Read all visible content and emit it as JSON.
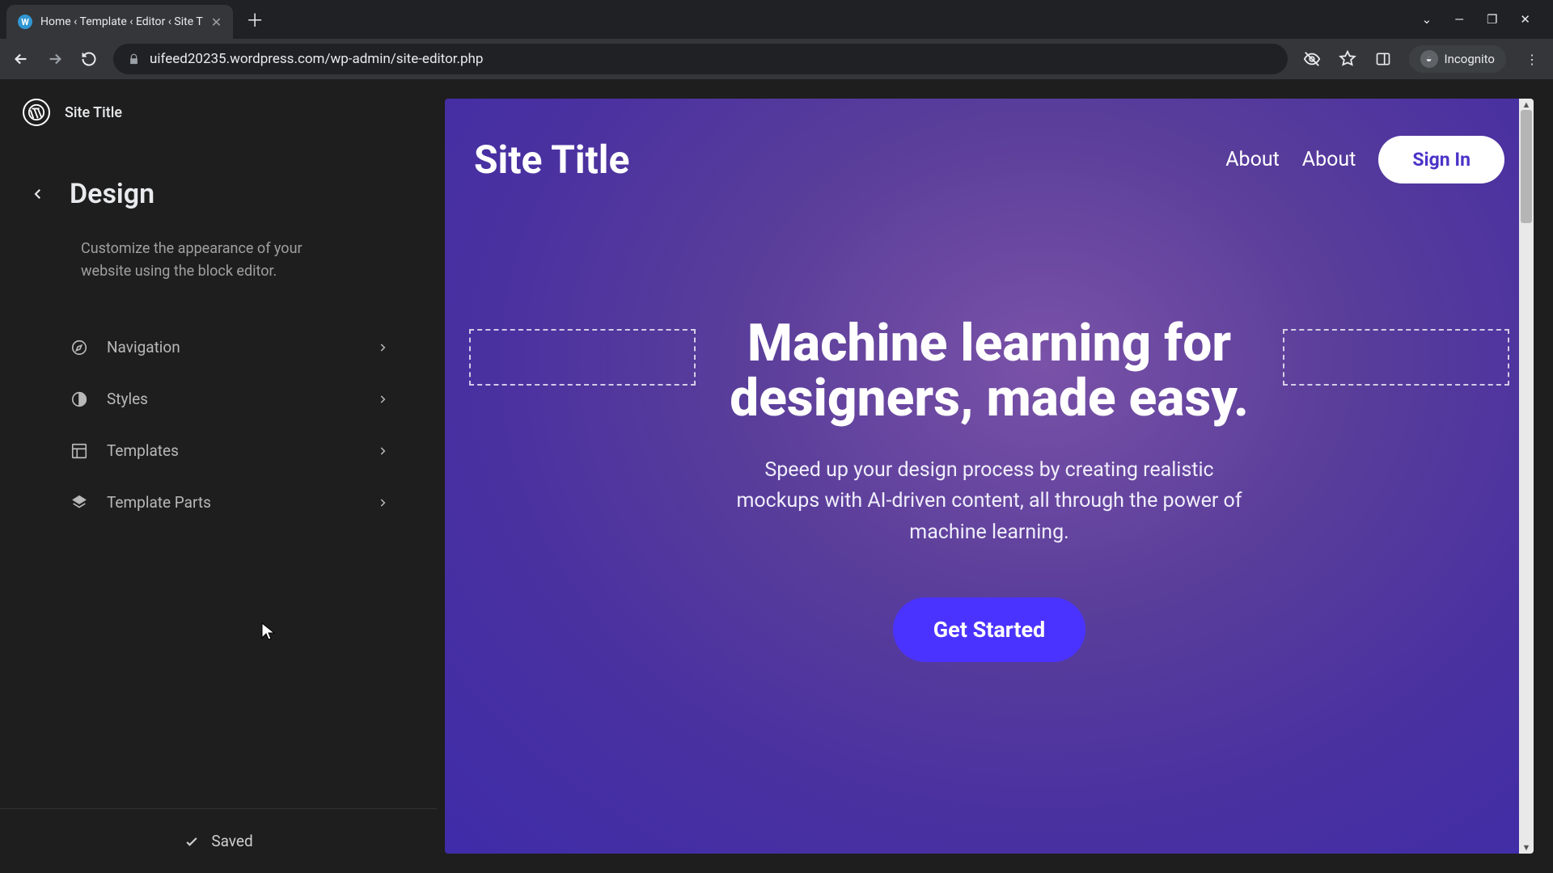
{
  "browser": {
    "tab_title": "Home ‹ Template ‹ Editor ‹ Site T",
    "url": "uifeed20235.wordpress.com/wp-admin/site-editor.php",
    "incognito_label": "Incognito"
  },
  "wp": {
    "site_title": "Site Title"
  },
  "panel": {
    "title": "Design",
    "description": "Customize the appearance of your website using the block editor.",
    "items": [
      {
        "label": "Navigation"
      },
      {
        "label": "Styles"
      },
      {
        "label": "Templates"
      },
      {
        "label": "Template Parts"
      }
    ],
    "saved_label": "Saved"
  },
  "preview": {
    "site_title": "Site Title",
    "nav": [
      "About",
      "About"
    ],
    "signin": "Sign In",
    "hero_title": "Machine learning for designers, made easy.",
    "hero_sub": "Speed up your design process by creating realistic mockups with AI-driven content, all through the power of machine learning.",
    "cta": "Get Started"
  }
}
